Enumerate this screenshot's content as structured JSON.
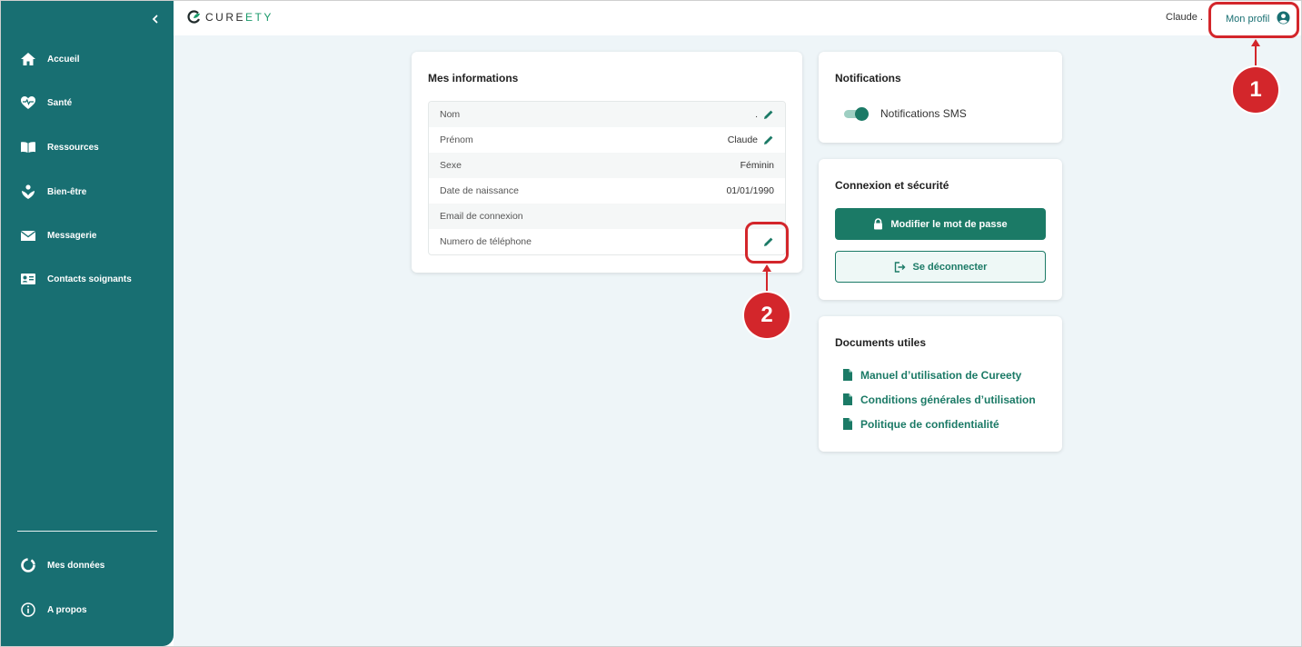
{
  "sidebar": {
    "items": [
      {
        "label": "Accueil",
        "icon": "home-icon"
      },
      {
        "label": "Santé",
        "icon": "heart-icon"
      },
      {
        "label": "Ressources",
        "icon": "book-icon"
      },
      {
        "label": "Bien-être",
        "icon": "wellbeing-icon"
      },
      {
        "label": "Messagerie",
        "icon": "mail-icon"
      },
      {
        "label": "Contacts soignants",
        "icon": "contact-card-icon"
      }
    ],
    "bottom_items": [
      {
        "label": "Mes données",
        "icon": "donut-icon"
      },
      {
        "label": "A propos",
        "icon": "info-icon"
      }
    ]
  },
  "header": {
    "brand_prefix": "CURE",
    "brand_suffix": "ETY",
    "user_name": "Claude .",
    "profile_label": "Mon profil"
  },
  "info_card": {
    "title": "Mes informations",
    "rows": [
      {
        "label": "Nom",
        "value": "."
      },
      {
        "label": "Prénom",
        "value": "Claude"
      },
      {
        "label": "Sexe",
        "value": "Féminin"
      },
      {
        "label": "Date de naissance",
        "value": "01/01/1990"
      },
      {
        "label": "Email de connexion",
        "value": ""
      },
      {
        "label": "Numero de téléphone",
        "value": ""
      }
    ]
  },
  "notifications_card": {
    "title": "Notifications",
    "sms_label": "Notifications SMS"
  },
  "security_card": {
    "title": "Connexion et sécurité",
    "change_password": "Modifier le mot de passe",
    "logout": "Se déconnecter"
  },
  "documents_card": {
    "title": "Documents utiles",
    "links": [
      "Manuel d’utilisation de Cureety",
      "Conditions générales d’utilisation",
      "Politique de confidentialité"
    ]
  },
  "annotations": {
    "step1": "1",
    "step2": "2"
  },
  "colors": {
    "sidebar": "#186f72",
    "accent": "#1b7a66",
    "annotation": "#d3262b"
  }
}
